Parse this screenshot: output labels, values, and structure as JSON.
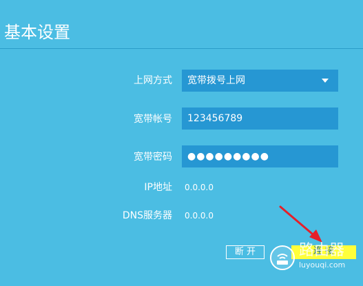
{
  "page": {
    "title": "基本设置"
  },
  "form": {
    "connection_type": {
      "label": "上网方式",
      "value": "宽带拨号上网"
    },
    "account": {
      "label": "宽带帐号",
      "value": "123456789"
    },
    "password": {
      "label": "宽带密码",
      "value": "●●●●●●●●●"
    },
    "ip": {
      "label": "IP地址",
      "value": "0.0.0.0"
    },
    "dns": {
      "label": "DNS服务器",
      "value": "0.0.0.0"
    }
  },
  "buttons": {
    "disconnect": "断 开",
    "connect": "连 接"
  },
  "watermark": {
    "brand": "路由器",
    "url": "luyouqi.com"
  },
  "colors": {
    "background": "#4bbde3",
    "field": "#2697d3",
    "connect_button": "#ffff3a",
    "arrow": "#e5202a"
  }
}
